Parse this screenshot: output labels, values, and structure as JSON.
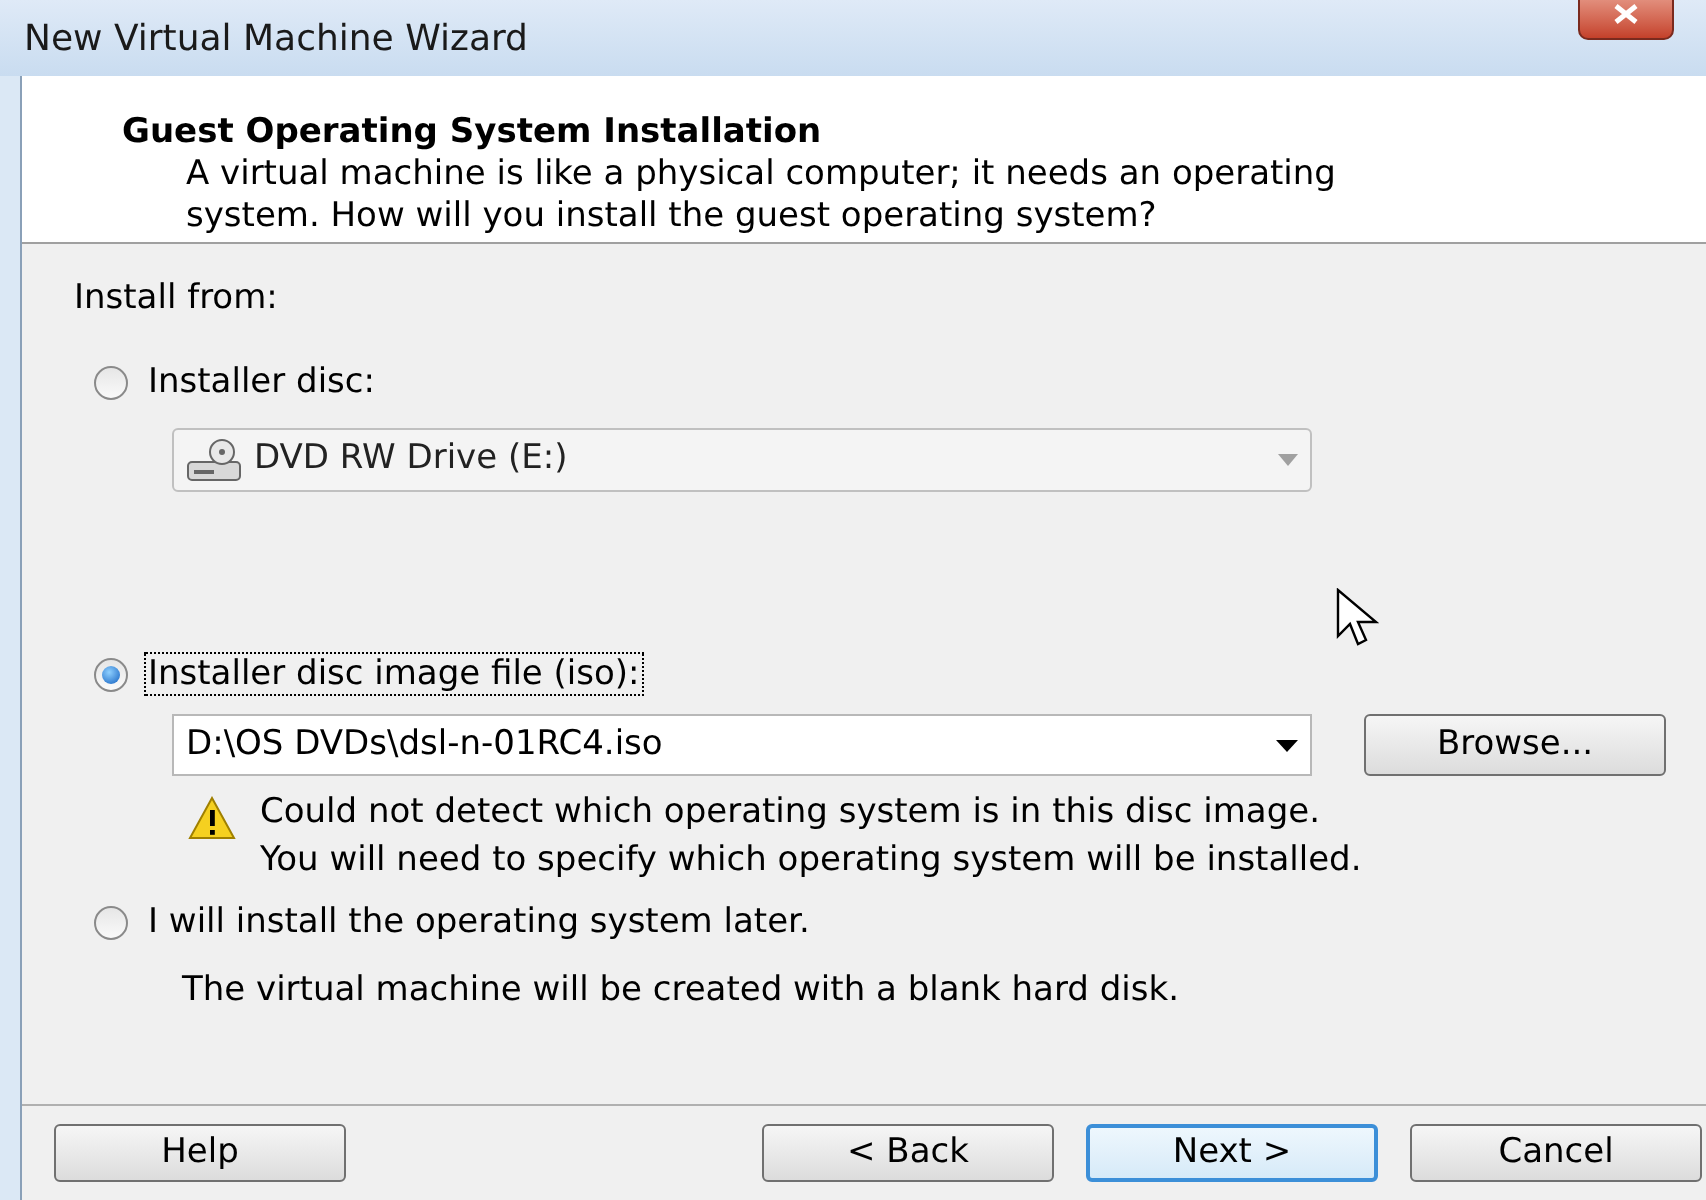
{
  "window": {
    "title": "New Virtual Machine Wizard"
  },
  "header": {
    "title": "Guest Operating System Installation",
    "subtitle_lines": [
      "A virtual machine is like a physical computer; it needs an operating",
      "system. How will you install the guest operating system?"
    ]
  },
  "install_from_label": "Install from:",
  "options": [
    {
      "label": "Installer disc:",
      "selected": false,
      "focused": false
    },
    {
      "label": "Installer disc image file (iso):",
      "selected": true,
      "focused": true
    },
    {
      "label": "I will install the operating system later.",
      "selected": false,
      "focused": false
    }
  ],
  "disc_drive": {
    "value": "DVD RW Drive (E:)",
    "disabled": true
  },
  "iso_path": {
    "value": "D:\\OS DVDs\\dsl-n-01RC4.iso"
  },
  "browse_button": "Browse...",
  "warning": {
    "lines": [
      "Could not detect which operating system is in this disc image.",
      "You will need to specify which operating system will be installed."
    ]
  },
  "later_note": "The virtual machine will be created with a blank hard disk.",
  "buttons": [
    {
      "label": "Help",
      "default": false
    },
    {
      "label": "< Back",
      "default": false
    },
    {
      "label": "Next >",
      "default": true
    },
    {
      "label": "Cancel",
      "default": false
    }
  ]
}
